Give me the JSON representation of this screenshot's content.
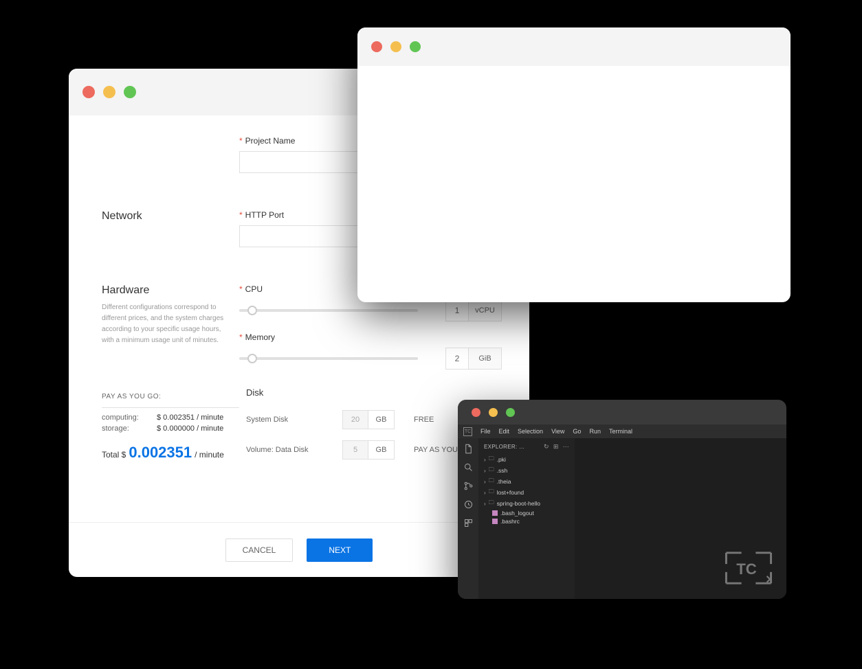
{
  "form": {
    "projectName": {
      "label": "Project Name"
    },
    "network": {
      "title": "Network",
      "httpPort": "HTTP Port"
    },
    "hardware": {
      "title": "Hardware",
      "desc": "Different configurations correspond to different prices, and the system charges according to your specific usage hours, with a minimum usage unit of minutes.",
      "cpu": {
        "label": "CPU",
        "value": "1",
        "unit": "vCPU"
      },
      "memory": {
        "label": "Memory",
        "value": "2",
        "unit": "GiB"
      }
    },
    "pay": {
      "title": "PAY AS YOU GO:",
      "rows": [
        {
          "label": "computing:",
          "value": "$ 0.002351 / minute"
        },
        {
          "label": "storage:",
          "value": "$ 0.000000 / minute"
        }
      ],
      "totalLabel": "Total $",
      "totalAmount": "0.002351",
      "totalUnit": "/ minute"
    },
    "disk": {
      "title": "Disk",
      "rows": [
        {
          "label": "System Disk",
          "value": "20",
          "unit": "GB",
          "mode": "FREE"
        },
        {
          "label": "Volume: Data Disk",
          "value": "5",
          "unit": "GB",
          "mode": "PAY AS YOU GO"
        }
      ]
    },
    "buttons": {
      "cancel": "CANCEL",
      "next": "NEXT"
    }
  },
  "ide": {
    "menu": [
      "File",
      "Edit",
      "Selection",
      "View",
      "Go",
      "Run",
      "Terminal"
    ],
    "explorerLabel": "EXPLORER: …",
    "tree": [
      {
        "type": "folder",
        "name": ".pki"
      },
      {
        "type": "folder",
        "name": ".ssh"
      },
      {
        "type": "folder",
        "name": ".theia"
      },
      {
        "type": "folder",
        "name": "lost+found"
      },
      {
        "type": "folder",
        "name": "spring-boot-hello"
      },
      {
        "type": "file",
        "name": ".bash_logout"
      },
      {
        "type": "file",
        "name": ".bashrc"
      }
    ],
    "logo": "TC"
  }
}
